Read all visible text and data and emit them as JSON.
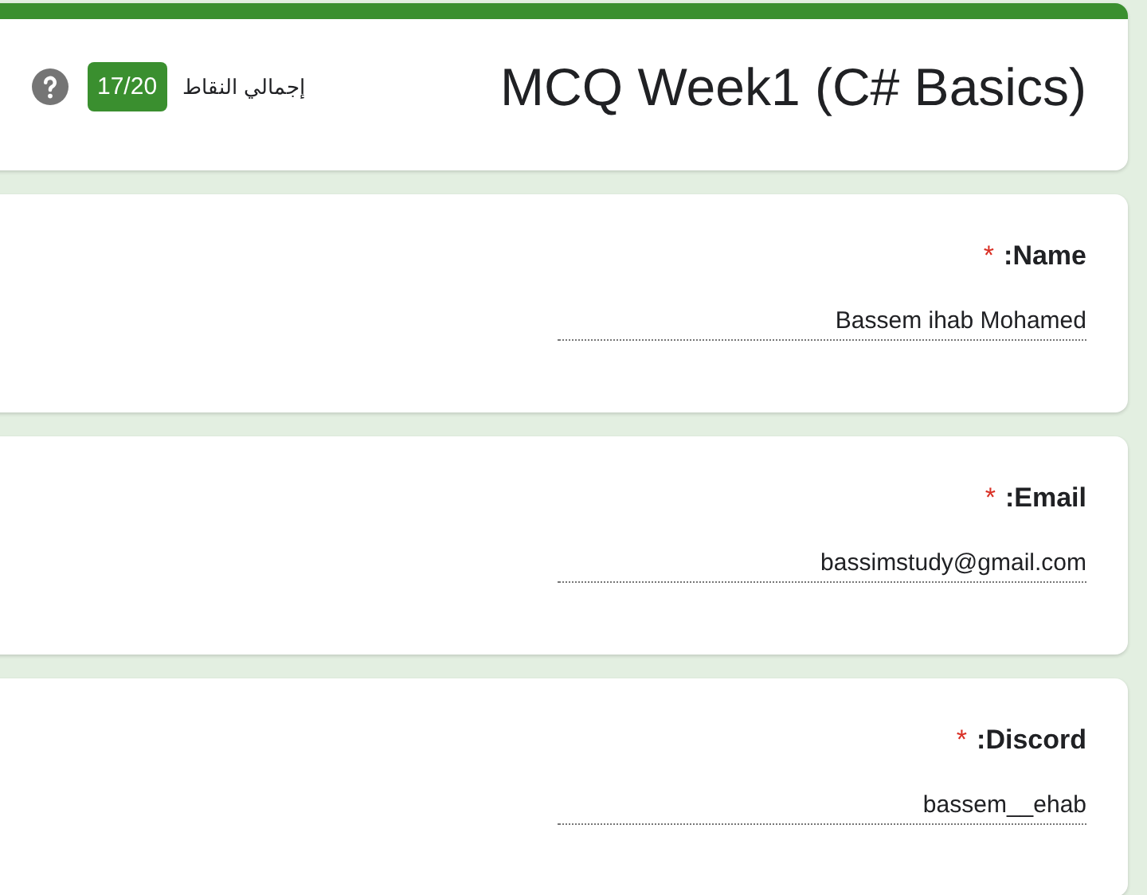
{
  "header": {
    "title": "MCQ Week1 (C# Basics)",
    "score_label": "إجمالي النقاط",
    "score": "17/20"
  },
  "questions": [
    {
      "label": ":Name",
      "required_mark": "*",
      "value": "Bassem ihab Mohamed"
    },
    {
      "label": ":Email",
      "required_mark": "*",
      "value": "bassimstudy@gmail.com"
    },
    {
      "label": ":Discord",
      "required_mark": "*",
      "value": "bassem__ehab"
    }
  ]
}
